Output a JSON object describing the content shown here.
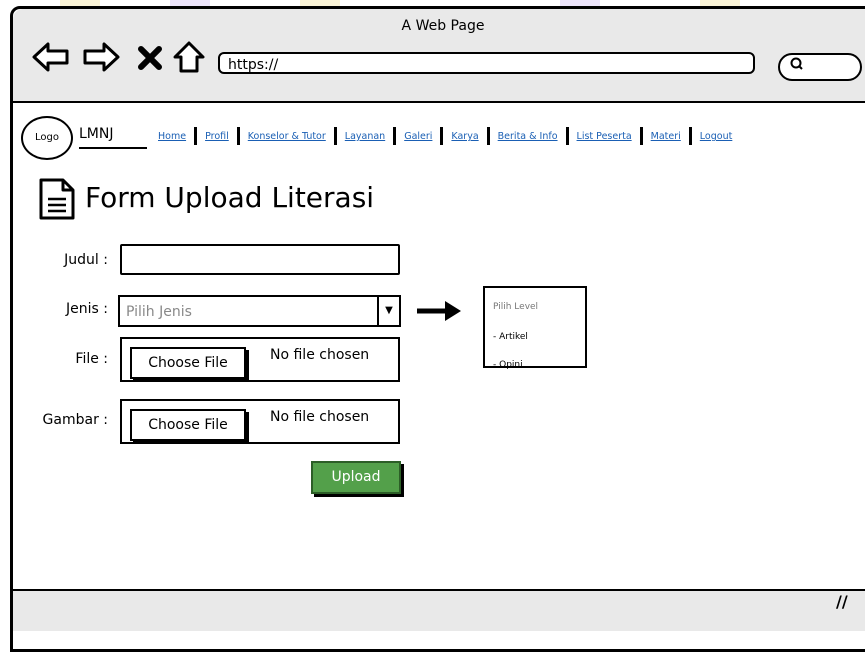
{
  "window": {
    "title": "A Web Page"
  },
  "browser": {
    "url": "https://",
    "back_icon": "back-arrow-icon",
    "forward_icon": "forward-arrow-icon",
    "close_icon": "close-icon",
    "home_icon": "home-icon",
    "search_icon": "search-icon"
  },
  "header": {
    "logo_label": "Logo",
    "brand": "LMNJ",
    "nav": [
      "Home",
      "Profil",
      "Konselor & Tutor",
      "Layanan",
      "Galeri",
      "Karya",
      "Berita & Info",
      "List Peserta",
      "Materi",
      "Logout"
    ]
  },
  "page": {
    "title": "Form Upload Literasi",
    "icon": "document-icon"
  },
  "form": {
    "judul_label": "Judul :",
    "judul_value": "",
    "jenis_label": "Jenis :",
    "jenis_placeholder": "Pilih Jenis",
    "file_label": "File :",
    "gambar_label": "Gambar :",
    "choose_file_label": "Choose File",
    "no_file_text": "No file chosen",
    "upload_label": "Upload"
  },
  "dropdown_preview": {
    "options": [
      "Pilih Level",
      "- Artikel",
      "- Opini"
    ]
  },
  "colors": {
    "upload_bg": "#53a04a",
    "link": "#1a5fb4",
    "chrome": "#e9e9e9"
  }
}
